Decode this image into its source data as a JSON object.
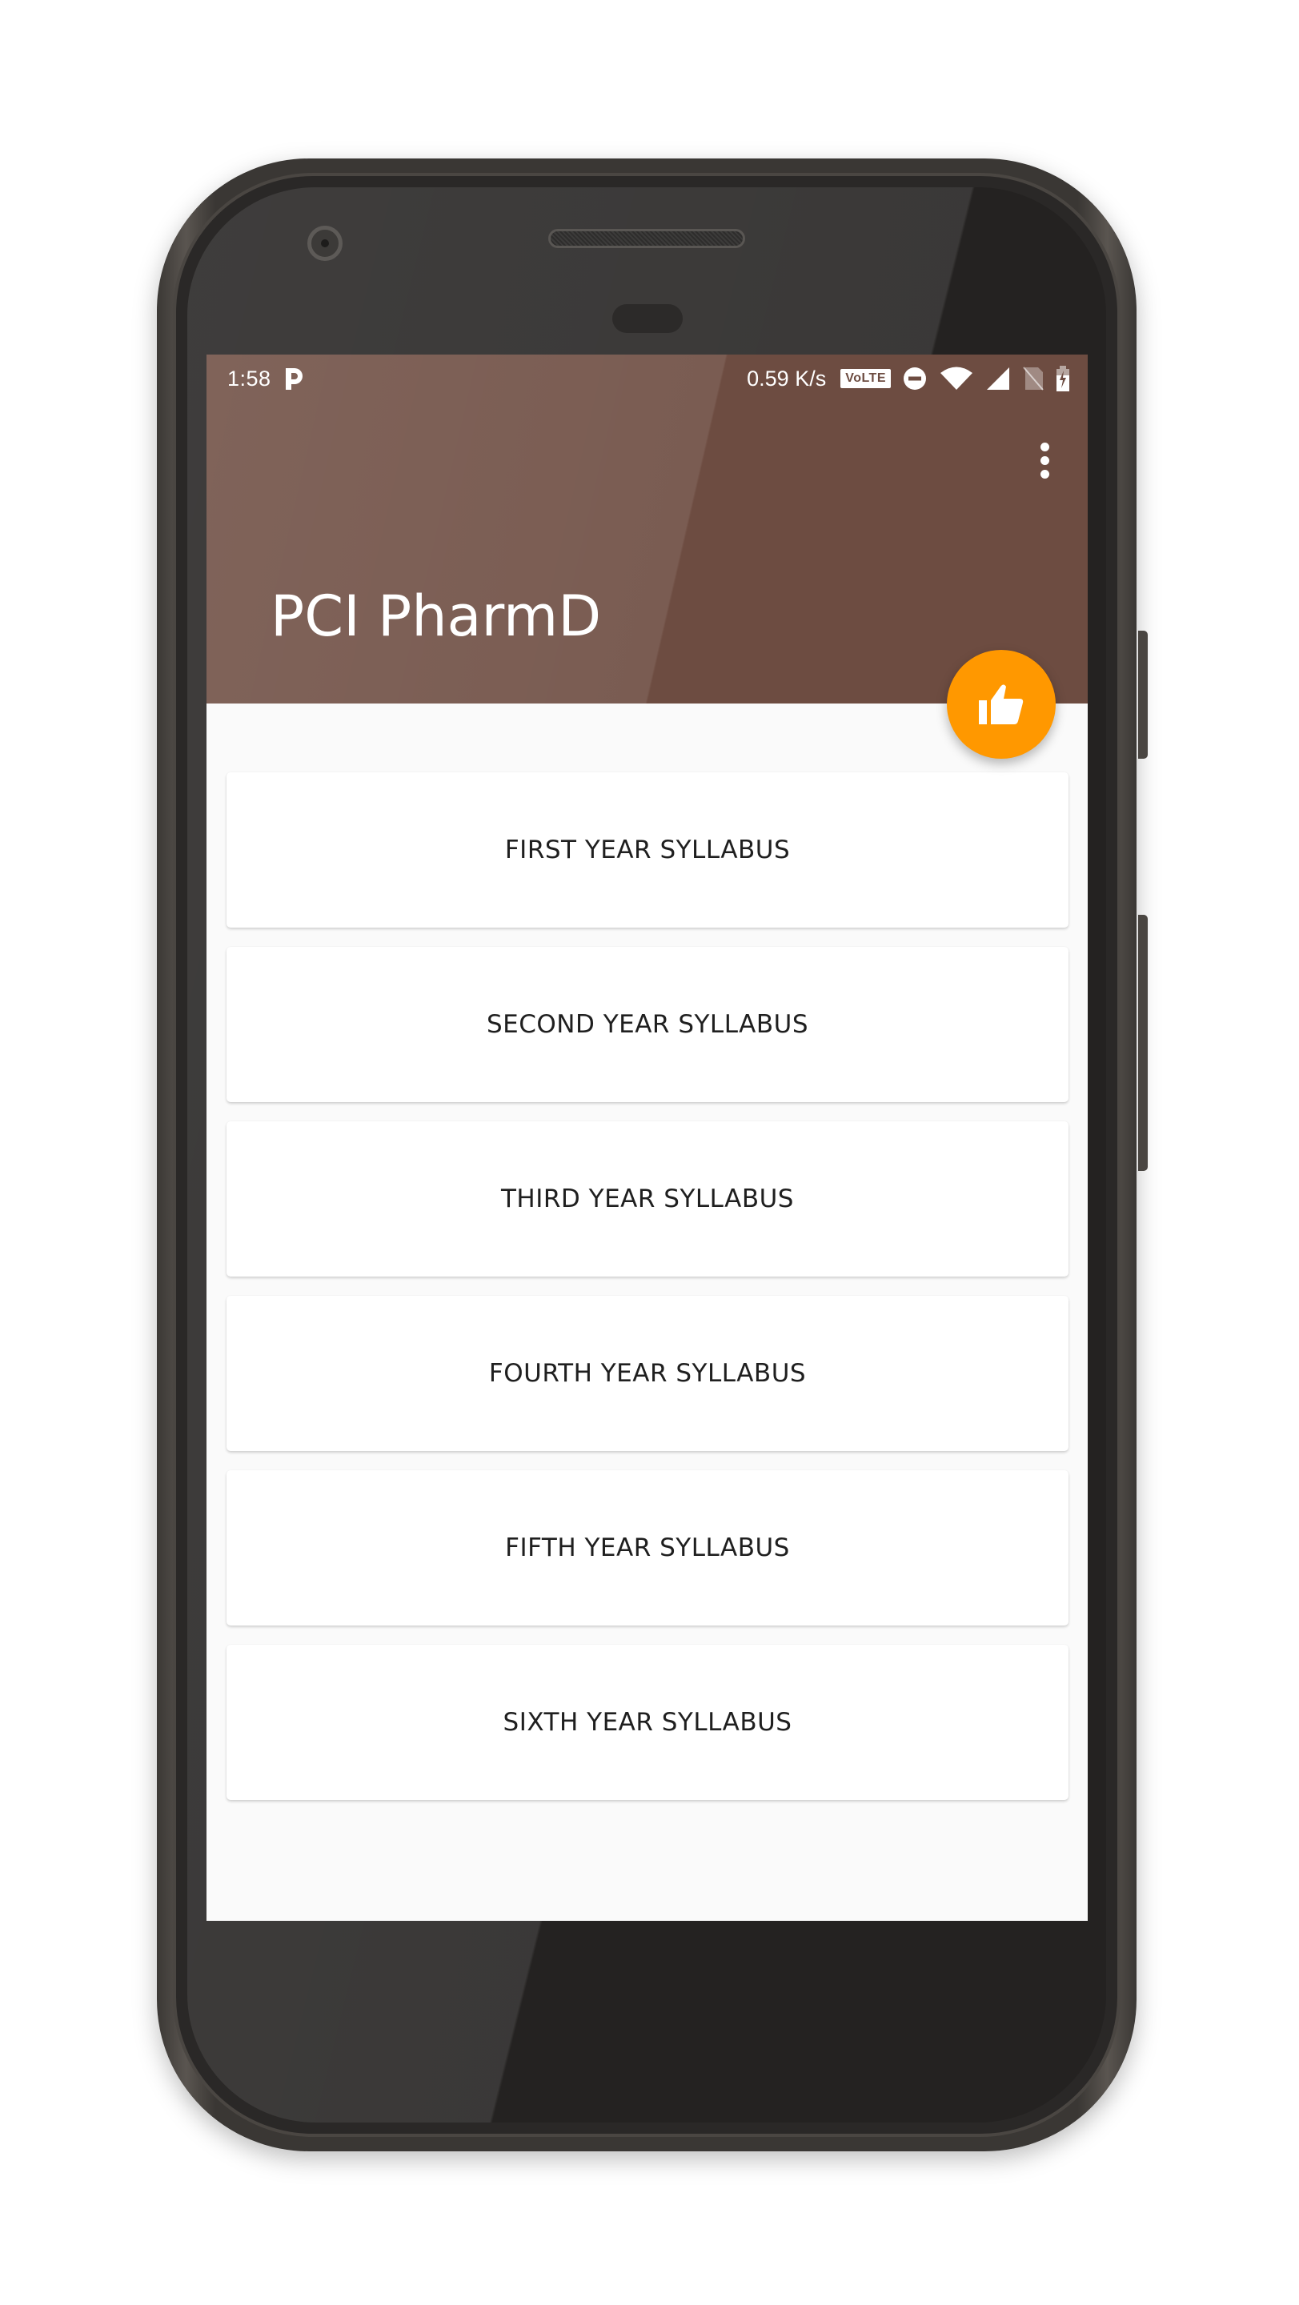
{
  "status_bar": {
    "time": "1:58",
    "network_speed": "0.59 K/s",
    "volte_label": "VoLTE",
    "icons": [
      "p-notification-icon",
      "volte-icon",
      "do-not-disturb-icon",
      "wifi-icon",
      "cell-signal-icon",
      "no-sim-icon",
      "battery-charging-icon"
    ]
  },
  "app_bar": {
    "title": "PCI PharmD",
    "background_color": "#6d4c41",
    "overflow_icon": "more-vert-icon"
  },
  "fab": {
    "icon": "thumb-up-icon",
    "color": "#ff9800"
  },
  "syllabus_list": [
    {
      "label": "FIRST YEAR SYLLABUS"
    },
    {
      "label": "SECOND YEAR SYLLABUS"
    },
    {
      "label": "THIRD YEAR SYLLABUS"
    },
    {
      "label": "FOURTH YEAR SYLLABUS"
    },
    {
      "label": "FIFTH YEAR SYLLABUS"
    },
    {
      "label": "SIXTH YEAR SYLLABUS"
    }
  ]
}
